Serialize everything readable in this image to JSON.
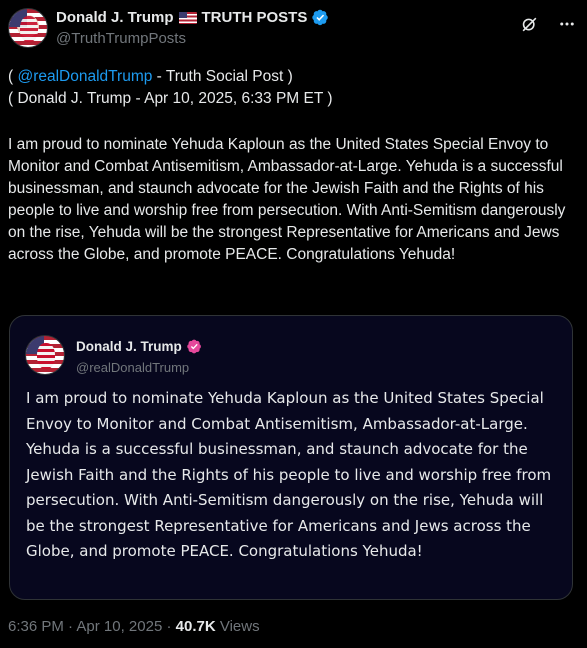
{
  "header": {
    "display_name": "Donald J. Trump",
    "flag_icon": "us-flag-emoji",
    "name_suffix": "TRUTH POSTS",
    "verified_icon": "verified-badge-icon",
    "handle": "@TruthTrumpPosts",
    "grok_icon": "grok-icon",
    "more_icon": "more-horizontal-icon"
  },
  "meta": {
    "line1_open": "( ",
    "mention": "@realDonaldTrump",
    "line1_rest": " - Truth Social Post )",
    "line2": "( Donald J. Trump - Apr 10, 2025, 6:33 PM ET )"
  },
  "post": {
    "text": "I am proud to nominate Yehuda Kaploun as the United States Special Envoy to Monitor and Combat Antisemitism, Ambassador-at-Large. Yehuda is a successful businessman, and staunch advocate for the Jewish Faith and the Rights of his people to live and worship free from persecution. With Anti-Semitism dangerously on the rise, Yehuda will be the strongest Representative for Americans and Jews across the Globe, and promote PEACE. Congratulations Yehuda!"
  },
  "quote": {
    "display_name": "Donald J. Trump",
    "badge_icon": "truth-verified-badge-icon",
    "handle": "@realDonaldTrump",
    "text": "I am proud to nominate Yehuda Kaploun as the United States Special Envoy to Monitor and Combat Antisemitism, Ambassador-at-Large. Yehuda is a successful businessman, and staunch advocate for the Jewish Faith and the Rights of his people to live and worship free from persecution. With Anti-Semitism dangerously on the rise, Yehuda will be the strongest Representative for Americans and Jews across the Globe, and promote PEACE. Congratulations Yehuda!"
  },
  "footer": {
    "time": "6:36 PM",
    "separator": " · ",
    "date": "Apr 10, 2025",
    "separator2": " · ",
    "views_count": "40.7K",
    "views_label": " Views"
  },
  "colors": {
    "background": "#000000",
    "text": "#e7e9ea",
    "muted": "#71767b",
    "link": "#1d9bf0",
    "quote_bg": "#07071e",
    "border": "#2f3336",
    "truth_badge": "#e5489b"
  }
}
